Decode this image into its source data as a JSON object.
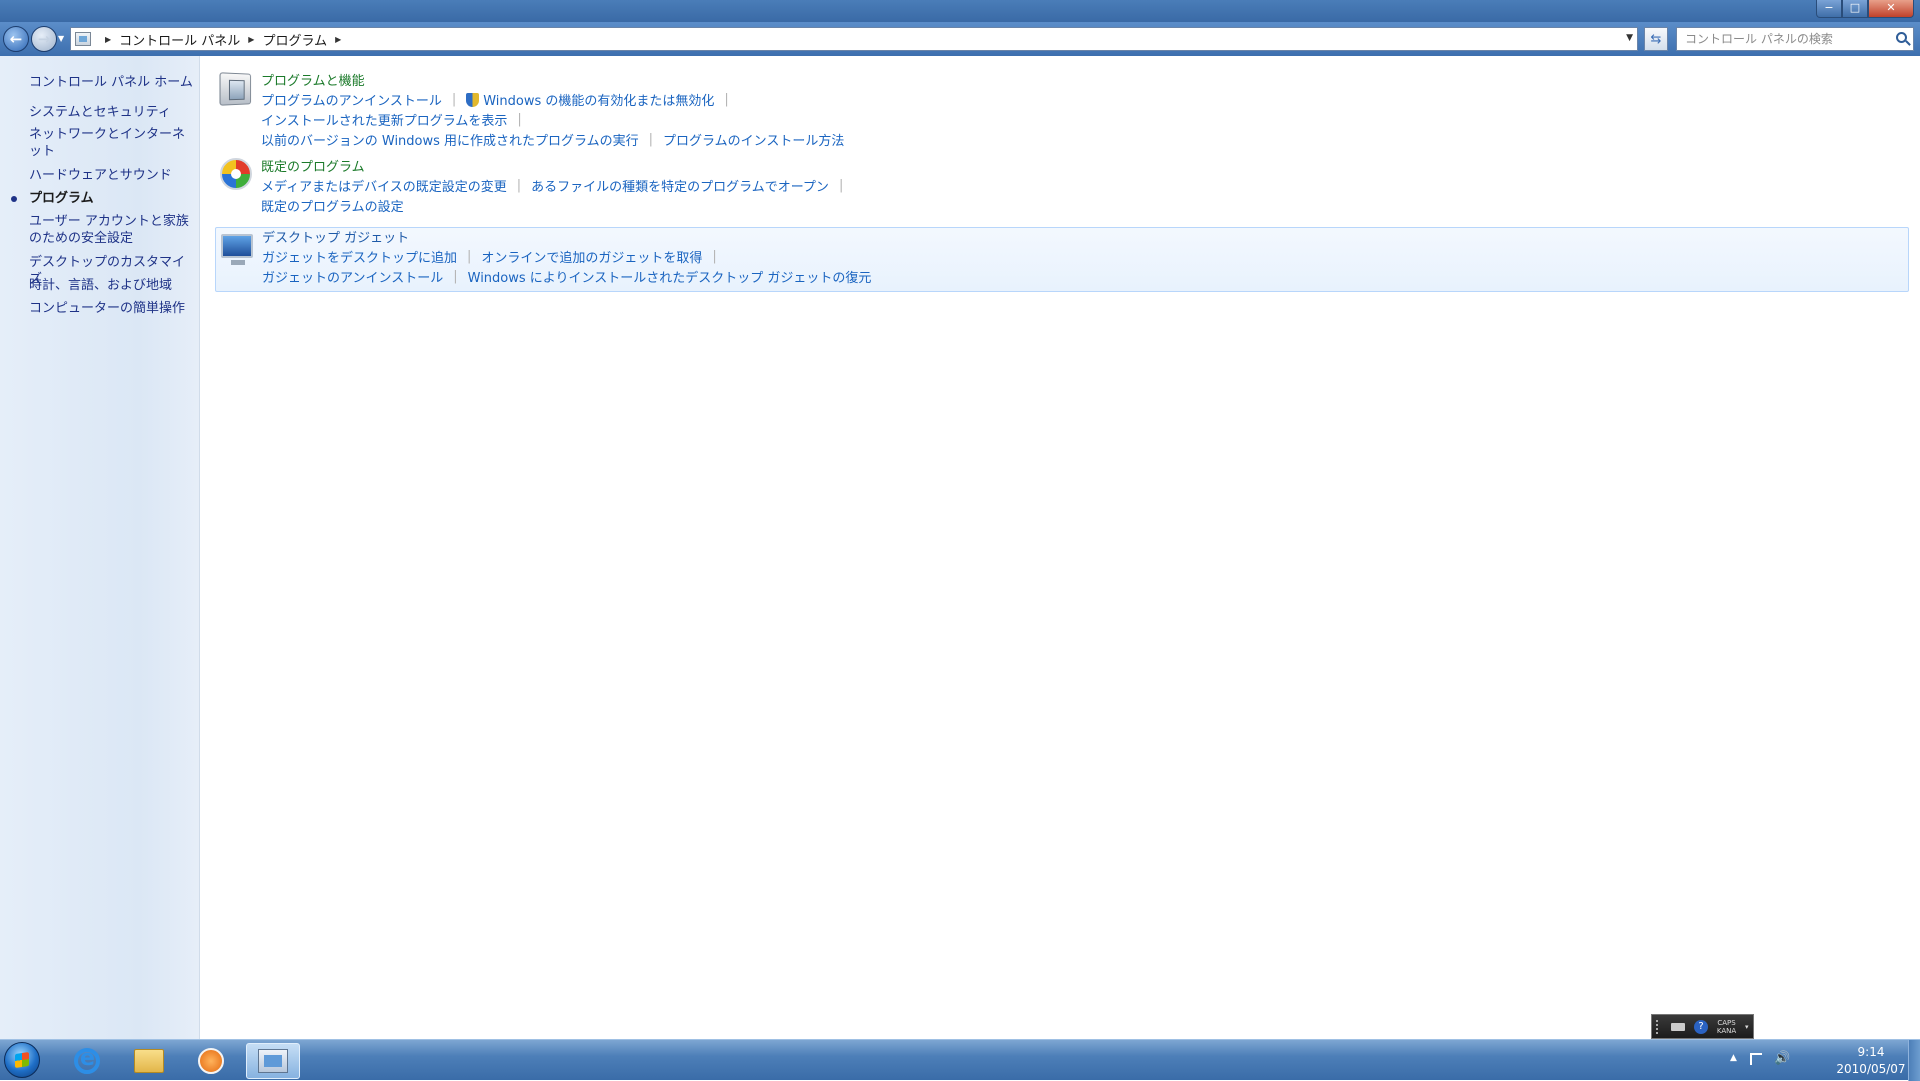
{
  "window": {
    "controls": {
      "minimize": "−",
      "maximize": "□",
      "close": "✕"
    }
  },
  "nav": {
    "breadcrumb": [
      "コントロール パネル",
      "プログラム"
    ],
    "search_placeholder": "コントロール パネルの検索"
  },
  "sidebar": {
    "home": "コントロール パネル ホーム",
    "items": [
      "システムとセキュリティ",
      "ネットワークとインターネット",
      "ハードウェアとサウンド",
      "プログラム",
      "ユーザー アカウントと家族のための安全設定",
      "デスクトップのカスタマイズ",
      "時計、言語、および地域",
      "コンピューターの簡単操作"
    ],
    "active_item": "プログラム"
  },
  "sections": [
    {
      "title": "プログラムと機能",
      "icon": "programs-and-features-icon",
      "links": [
        [
          "プログラムのアンインストール",
          "Windows の機能の有効化または無効化"
        ],
        [
          "インストールされた更新プログラムを表示"
        ],
        [
          "以前のバージョンの Windows 用に作成されたプログラムの実行",
          "プログラムのインストール方法"
        ]
      ]
    },
    {
      "title": "既定のプログラム",
      "icon": "default-programs-icon",
      "links": [
        [
          "メディアまたはデバイスの既定設定の変更",
          "あるファイルの種類を特定のプログラムでオープン"
        ],
        [
          "既定のプログラムの設定"
        ]
      ]
    },
    {
      "title": "デスクトップ ガジェット",
      "icon": "desktop-gadgets-icon",
      "links": [
        [
          "ガジェットをデスクトップに追加",
          "オンラインで追加のガジェットを取得"
        ],
        [
          "ガジェットのアンインストール",
          "Windows によりインストールされたデスクトップ ガジェットの復元"
        ]
      ]
    }
  ],
  "ime": {
    "caps": "CAPS",
    "kana": "KANA",
    "help": "?"
  },
  "taskbar": {
    "pinned": [
      "internet-explorer-icon",
      "windows-explorer-icon",
      "media-player-icon",
      "control-panel-icon"
    ],
    "clock_time": "9:14",
    "clock_date": "2010/05/07"
  },
  "colors": {
    "link": "#1a64c0",
    "section_title": "#1b7a2a",
    "sidebar_link": "#1e3287",
    "titlebar": "#3a6aa6"
  }
}
